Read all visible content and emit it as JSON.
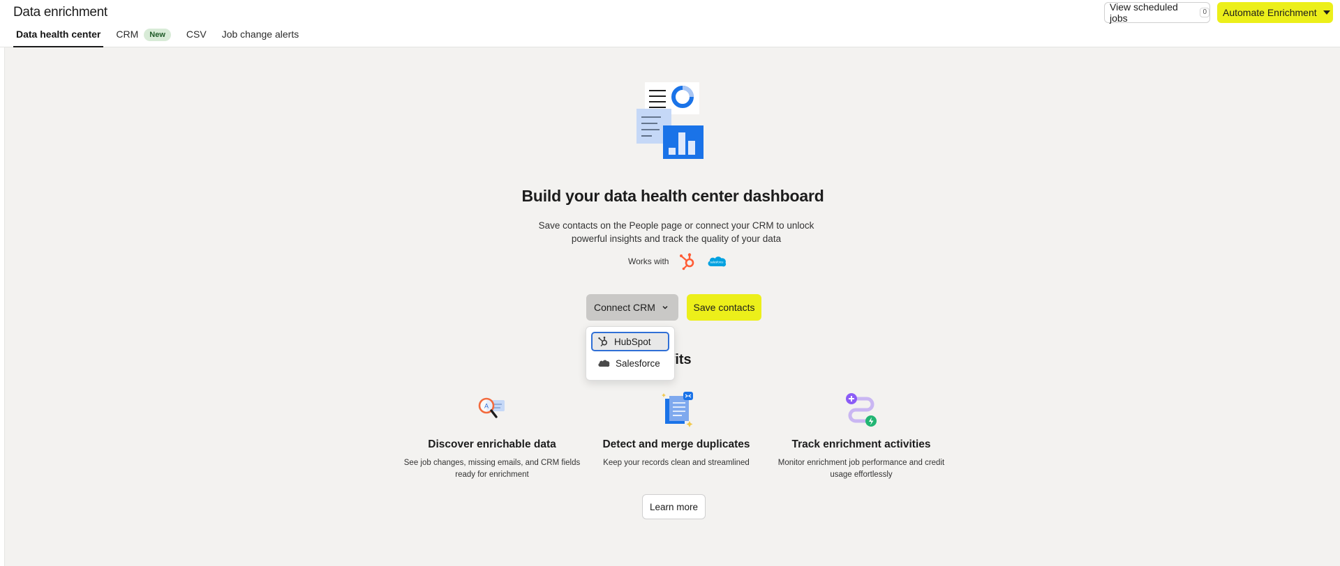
{
  "header": {
    "title": "Data enrichment",
    "tabs": [
      {
        "label": "Data health center",
        "active": true
      },
      {
        "label": "CRM",
        "badge": "New"
      },
      {
        "label": "CSV"
      },
      {
        "label": "Job change alerts"
      }
    ],
    "scheduled_jobs_label": "View scheduled jobs",
    "scheduled_jobs_count": "0",
    "automate_label": "Automate Enrichment"
  },
  "hero": {
    "title": "Build your data health center dashboard",
    "description": "Save contacts on the People page or connect your CRM to unlock powerful insights and track the quality of your data",
    "works_with": "Works with",
    "logos": [
      "hubspot-logo",
      "salesforce-logo"
    ],
    "connect_label": "Connect CRM",
    "save_label": "Save contacts"
  },
  "dropdown": {
    "items": [
      {
        "label": "HubSpot",
        "icon": "hubspot-icon",
        "focused": true
      },
      {
        "label": "Salesforce",
        "icon": "salesforce-cloud-icon"
      }
    ]
  },
  "benefits": {
    "heading_visible_fragment": "nefits",
    "items": [
      {
        "title": "Discover enrichable data",
        "desc": "See job changes, missing emails, and CRM fields ready for enrichment",
        "icon": "magnifier-icon"
      },
      {
        "title": "Detect and merge duplicates",
        "desc": "Keep your records clean and streamlined",
        "icon": "duplicate-documents-icon"
      },
      {
        "title": "Track enrichment activities",
        "desc": "Monitor enrichment job performance and credit usage effortlessly",
        "icon": "activity-path-icon"
      }
    ],
    "learn_more_label": "Learn more"
  },
  "colors": {
    "accent_yellow": "#ecef1a",
    "main_bg": "#f3f2f0",
    "connect_bg": "#c9c8c6",
    "focus_blue": "#2f6fd6",
    "hubspot_orange": "#ff5c35",
    "salesforce_blue": "#00a1e0",
    "illustration_blue": "#1a73e8"
  }
}
